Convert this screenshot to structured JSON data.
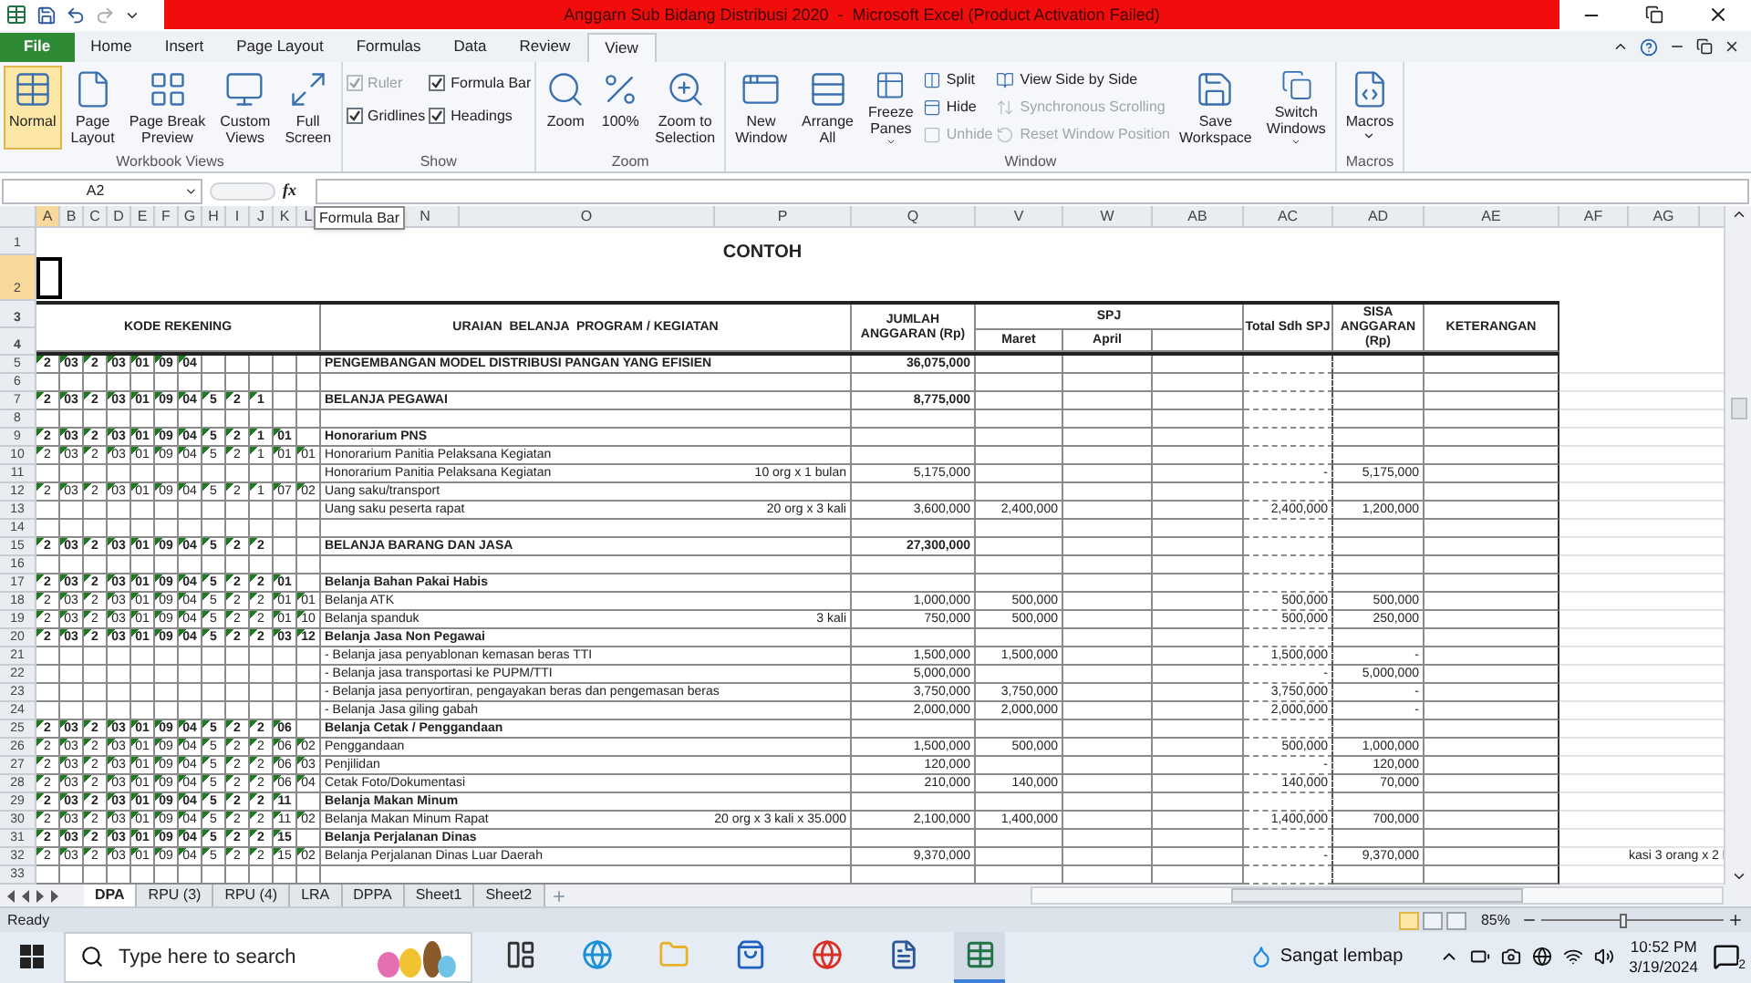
{
  "window": {
    "title": "Anggarn Sub Bidang Distribusi 2020  -  Microsoft Excel (Product Activation Failed)"
  },
  "ribbon_tabs": [
    {
      "label": "File",
      "kind": "file",
      "selected": false
    },
    {
      "label": "Home",
      "kind": "tab",
      "selected": false
    },
    {
      "label": "Insert",
      "kind": "tab",
      "selected": false
    },
    {
      "label": "Page Layout",
      "kind": "tab",
      "selected": false
    },
    {
      "label": "Formulas",
      "kind": "tab",
      "selected": false
    },
    {
      "label": "Data",
      "kind": "tab",
      "selected": false
    },
    {
      "label": "Review",
      "kind": "tab",
      "selected": false
    },
    {
      "label": "View",
      "kind": "tab",
      "selected": true
    }
  ],
  "ribbon_groups": [
    {
      "label": "Workbook Views",
      "items": [
        {
          "kind": "large",
          "label": [
            "Normal"
          ],
          "selected": true
        },
        {
          "kind": "large",
          "label": [
            "Page",
            "Layout"
          ],
          "selected": false
        },
        {
          "kind": "large",
          "label": [
            "Page Break",
            "Preview"
          ],
          "selected": false
        },
        {
          "kind": "large",
          "label": [
            "Custom",
            "Views"
          ],
          "selected": false
        },
        {
          "kind": "large",
          "label": [
            "Full",
            "Screen"
          ],
          "selected": false
        }
      ]
    },
    {
      "label": "Show",
      "items": [
        {
          "kind": "check",
          "label": "Ruler",
          "checked": true,
          "disabled": true
        },
        {
          "kind": "check",
          "label": "Gridlines",
          "checked": true,
          "disabled": false
        },
        {
          "kind": "check",
          "label": "Formula Bar",
          "checked": true,
          "disabled": false
        },
        {
          "kind": "check",
          "label": "Headings",
          "checked": true,
          "disabled": false
        }
      ]
    },
    {
      "label": "Zoom",
      "items": [
        {
          "kind": "large",
          "label": [
            "Zoom"
          ]
        },
        {
          "kind": "large",
          "label": [
            "100%"
          ]
        },
        {
          "kind": "large",
          "label": [
            "Zoom to",
            "Selection"
          ]
        }
      ]
    },
    {
      "label": "Window",
      "items": [
        {
          "kind": "large",
          "label": [
            "New",
            "Window"
          ]
        },
        {
          "kind": "large",
          "label": [
            "Arrange",
            "All"
          ]
        },
        {
          "kind": "large",
          "label": [
            "Freeze",
            "Panes"
          ],
          "has_menu": true
        },
        {
          "kind": "small",
          "label": "Split",
          "disabled": false
        },
        {
          "kind": "small",
          "label": "Hide",
          "disabled": false
        },
        {
          "kind": "small",
          "label": "Unhide",
          "disabled": true
        },
        {
          "kind": "small",
          "label": "View Side by Side",
          "disabled": false
        },
        {
          "kind": "small",
          "label": "Synchronous Scrolling",
          "disabled": true
        },
        {
          "kind": "small",
          "label": "Reset Window Position",
          "disabled": true
        },
        {
          "kind": "large",
          "label": [
            "Save",
            "Workspace"
          ]
        },
        {
          "kind": "large",
          "label": [
            "Switch",
            "Windows"
          ],
          "has_menu": true
        }
      ]
    },
    {
      "label": "Macros",
      "items": [
        {
          "kind": "large",
          "label": [
            "Macros"
          ],
          "has_menu": true
        }
      ]
    }
  ],
  "formula_bar": {
    "name_box": "A2",
    "fx": "fx",
    "tooltip": "Formula Bar"
  },
  "columns": [
    {
      "label": "A",
      "selected": true
    },
    {
      "label": "B",
      "selected": false
    },
    {
      "label": "C",
      "selected": false
    },
    {
      "label": "D",
      "selected": false
    },
    {
      "label": "E",
      "selected": false
    },
    {
      "label": "F",
      "selected": false
    },
    {
      "label": "G",
      "selected": false
    },
    {
      "label": "H",
      "selected": false
    },
    {
      "label": "I",
      "selected": false
    },
    {
      "label": "J",
      "selected": false
    },
    {
      "label": "K",
      "selected": false
    },
    {
      "label": "L",
      "selected": false
    },
    {
      "label": "N",
      "selected": false
    },
    {
      "label": "O",
      "selected": false
    },
    {
      "label": "P",
      "selected": false
    },
    {
      "label": "Q",
      "selected": false
    },
    {
      "label": "V",
      "selected": false
    },
    {
      "label": "W",
      "selected": false
    },
    {
      "label": "AB",
      "selected": false
    },
    {
      "label": "AC",
      "selected": false
    },
    {
      "label": "AD",
      "selected": false
    },
    {
      "label": "AE",
      "selected": false
    },
    {
      "label": "AF",
      "selected": false
    },
    {
      "label": "AG",
      "selected": false
    }
  ],
  "sheet": {
    "title": "CONTOH",
    "top_rows": [
      {
        "number": "1",
        "selected": false
      },
      {
        "number": "2",
        "selected": true
      }
    ],
    "header_rows": [
      {
        "number": "3",
        "selected": false
      },
      {
        "number": "4",
        "selected": false
      }
    ],
    "headers": {
      "code": "KODE REKENING",
      "description": "URAIAN  BELANJA  PROGRAM / KEGIATAN",
      "amount": "JUMLAH ANGGARAN (Rp)",
      "spj": "SPJ",
      "months": [
        "Maret",
        "April"
      ],
      "total": "Total Sdh SPJ",
      "remaining": "SISA ANGGARAN (Rp)",
      "notes": "KETERANGAN"
    },
    "rows": [
      {
        "number": "5",
        "selected": false,
        "bold": true,
        "code": [
          "2",
          "03",
          "2",
          "03",
          "01",
          "09",
          "04"
        ],
        "description": "PENGEMBANGAN MODEL DISTRIBUSI PANGAN YANG EFISIEN",
        "amount": "36,075,000"
      },
      {
        "number": "6",
        "selected": false
      },
      {
        "number": "7",
        "selected": false,
        "bold": true,
        "code": [
          "2",
          "03",
          "2",
          "03",
          "01",
          "09",
          "04",
          "5",
          "2",
          "1"
        ],
        "description": "BELANJA PEGAWAI",
        "amount": "8,775,000"
      },
      {
        "number": "8",
        "selected": false
      },
      {
        "number": "9",
        "selected": false,
        "bold": true,
        "code": [
          "2",
          "03",
          "2",
          "03",
          "01",
          "09",
          "04",
          "5",
          "2",
          "1",
          "01"
        ],
        "description": "Honorarium PNS"
      },
      {
        "number": "10",
        "selected": false,
        "bold": false,
        "code": [
          "2",
          "03",
          "2",
          "03",
          "01",
          "09",
          "04",
          "5",
          "2",
          "1",
          "01",
          "01"
        ],
        "description": "Honorarium Panitia Pelaksana Kegiatan"
      },
      {
        "number": "11",
        "selected": false,
        "bold": false,
        "description": "Honorarium Panitia Pelaksana Kegiatan",
        "note": "10 org x 1 bulan",
        "amount": "5,175,000",
        "total": "-",
        "remaining": "5,175,000"
      },
      {
        "number": "12",
        "selected": false,
        "bold": false,
        "code": [
          "2",
          "03",
          "2",
          "03",
          "01",
          "09",
          "04",
          "5",
          "2",
          "1",
          "07",
          "02"
        ],
        "description": "Uang saku/transport"
      },
      {
        "number": "13",
        "selected": false,
        "bold": false,
        "description": "Uang saku peserta rapat",
        "note": "20 org x 3 kali",
        "amount": "3,600,000",
        "march": "2,400,000",
        "total": "2,400,000",
        "remaining": "1,200,000"
      },
      {
        "number": "14",
        "selected": false
      },
      {
        "number": "15",
        "selected": false,
        "bold": true,
        "code": [
          "2",
          "03",
          "2",
          "03",
          "01",
          "09",
          "04",
          "5",
          "2",
          "2"
        ],
        "description": "BELANJA  BARANG DAN JASA",
        "amount": "27,300,000"
      },
      {
        "number": "16",
        "selected": false
      },
      {
        "number": "17",
        "selected": false,
        "bold": true,
        "code": [
          "2",
          "03",
          "2",
          "03",
          "01",
          "09",
          "04",
          "5",
          "2",
          "2",
          "01"
        ],
        "description": "Belanja Bahan Pakai Habis"
      },
      {
        "number": "18",
        "selected": false,
        "bold": false,
        "code": [
          "2",
          "03",
          "2",
          "03",
          "01",
          "09",
          "04",
          "5",
          "2",
          "2",
          "01",
          "01"
        ],
        "description": "Belanja ATK",
        "amount": "1,000,000",
        "march": "500,000",
        "total": "500,000",
        "remaining": "500,000"
      },
      {
        "number": "19",
        "selected": false,
        "bold": false,
        "code": [
          "2",
          "03",
          "2",
          "03",
          "01",
          "09",
          "04",
          "5",
          "2",
          "2",
          "01",
          "10"
        ],
        "description": "Belanja spanduk",
        "note": "3 kali",
        "amount": "750,000",
        "march": "500,000",
        "total": "500,000",
        "remaining": "250,000"
      },
      {
        "number": "20",
        "selected": false,
        "bold": true,
        "code": [
          "2",
          "03",
          "2",
          "03",
          "01",
          "09",
          "04",
          "5",
          "2",
          "2",
          "03",
          "12"
        ],
        "description": "Belanja Jasa Non Pegawai"
      },
      {
        "number": "21",
        "selected": false,
        "bold": false,
        "description": "- Belanja jasa penyablonan kemasan beras TTI",
        "amount": "1,500,000",
        "march": "1,500,000",
        "total": "1,500,000",
        "remaining": "-"
      },
      {
        "number": "22",
        "selected": false,
        "bold": false,
        "description": "- Belanja jasa transportasi ke PUPM/TTI",
        "amount": "5,000,000",
        "total": "-",
        "remaining": "5,000,000"
      },
      {
        "number": "23",
        "selected": false,
        "bold": false,
        "description": "- Belanja jasa penyortiran, pengayakan beras dan pengemasan beras",
        "amount": "3,750,000",
        "march": "3,750,000",
        "total": "3,750,000",
        "remaining": "-"
      },
      {
        "number": "24",
        "selected": false,
        "bold": false,
        "description": "- Belanja Jasa giling gabah",
        "amount": "2,000,000",
        "march": "2,000,000",
        "total": "2,000,000",
        "remaining": "-"
      },
      {
        "number": "25",
        "selected": false,
        "bold": true,
        "code": [
          "2",
          "03",
          "2",
          "03",
          "01",
          "09",
          "04",
          "5",
          "2",
          "2",
          "06"
        ],
        "description": "Belanja Cetak / Penggandaan"
      },
      {
        "number": "26",
        "selected": false,
        "bold": false,
        "code": [
          "2",
          "03",
          "2",
          "03",
          "01",
          "09",
          "04",
          "5",
          "2",
          "2",
          "06",
          "02"
        ],
        "description": "Penggandaan",
        "amount": "1,500,000",
        "march": "500,000",
        "total": "500,000",
        "remaining": "1,000,000"
      },
      {
        "number": "27",
        "selected": false,
        "bold": false,
        "code": [
          "2",
          "03",
          "2",
          "03",
          "01",
          "09",
          "04",
          "5",
          "2",
          "2",
          "06",
          "03"
        ],
        "description": "Penjilidan",
        "amount": "120,000",
        "total": "-",
        "remaining": "120,000"
      },
      {
        "number": "28",
        "selected": false,
        "bold": false,
        "code": [
          "2",
          "03",
          "2",
          "03",
          "01",
          "09",
          "04",
          "5",
          "2",
          "2",
          "06",
          "04"
        ],
        "description": "Cetak Foto/Dokumentasi",
        "amount": "210,000",
        "march": "140,000",
        "total": "140,000",
        "remaining": "70,000"
      },
      {
        "number": "29",
        "selected": false,
        "bold": true,
        "code": [
          "2",
          "03",
          "2",
          "03",
          "01",
          "09",
          "04",
          "5",
          "2",
          "2",
          "11"
        ],
        "description": "Belanja Makan Minum"
      },
      {
        "number": "30",
        "selected": false,
        "bold": false,
        "code": [
          "2",
          "03",
          "2",
          "03",
          "01",
          "09",
          "04",
          "5",
          "2",
          "2",
          "11",
          "02"
        ],
        "description": "Belanja Makan Minum Rapat",
        "note": "20 org x 3 kali x 35.000",
        "amount": "2,100,000",
        "march": "1,400,000",
        "total": "1,400,000",
        "remaining": "700,000"
      },
      {
        "number": "31",
        "selected": false,
        "bold": true,
        "code": [
          "2",
          "03",
          "2",
          "03",
          "01",
          "09",
          "04",
          "5",
          "2",
          "2",
          "15"
        ],
        "description": "Belanja Perjalanan Dinas"
      },
      {
        "number": "32",
        "selected": false,
        "bold": false,
        "code": [
          "2",
          "03",
          "2",
          "03",
          "01",
          "09",
          "04",
          "5",
          "2",
          "2",
          "15",
          "02"
        ],
        "description": "Belanja Perjalanan Dinas Luar Daerah",
        "amount": "9,370,000",
        "total": "-",
        "remaining": "9,370,000",
        "side_note": "kasi 3 orang x 2 l"
      },
      {
        "number": "33",
        "selected": false
      }
    ]
  },
  "sheet_tabs": [
    {
      "label": "DPA",
      "selected": true
    },
    {
      "label": "RPU (3)",
      "selected": false
    },
    {
      "label": "RPU (4)",
      "selected": false
    },
    {
      "label": "LRA",
      "selected": false
    },
    {
      "label": "DPPA",
      "selected": false
    },
    {
      "label": "Sheet1",
      "selected": false
    },
    {
      "label": "Sheet2",
      "selected": false
    }
  ],
  "status_bar": {
    "text": "Ready",
    "views": [
      {
        "selected": true
      },
      {
        "selected": false
      },
      {
        "selected": false
      }
    ],
    "zoom": "85%",
    "zoom_level": {
      "level": 0.45
    }
  },
  "taskbar": {
    "search_placeholder": "Type here to search",
    "apps": [
      {
        "selected": false
      },
      {
        "selected": false
      },
      {
        "selected": false
      },
      {
        "selected": false
      },
      {
        "selected": false
      },
      {
        "selected": false
      },
      {
        "selected": true
      }
    ],
    "weather": "Sangat lembap",
    "time": "10:52 PM",
    "date": "3/19/2024",
    "notifications": "2"
  }
}
